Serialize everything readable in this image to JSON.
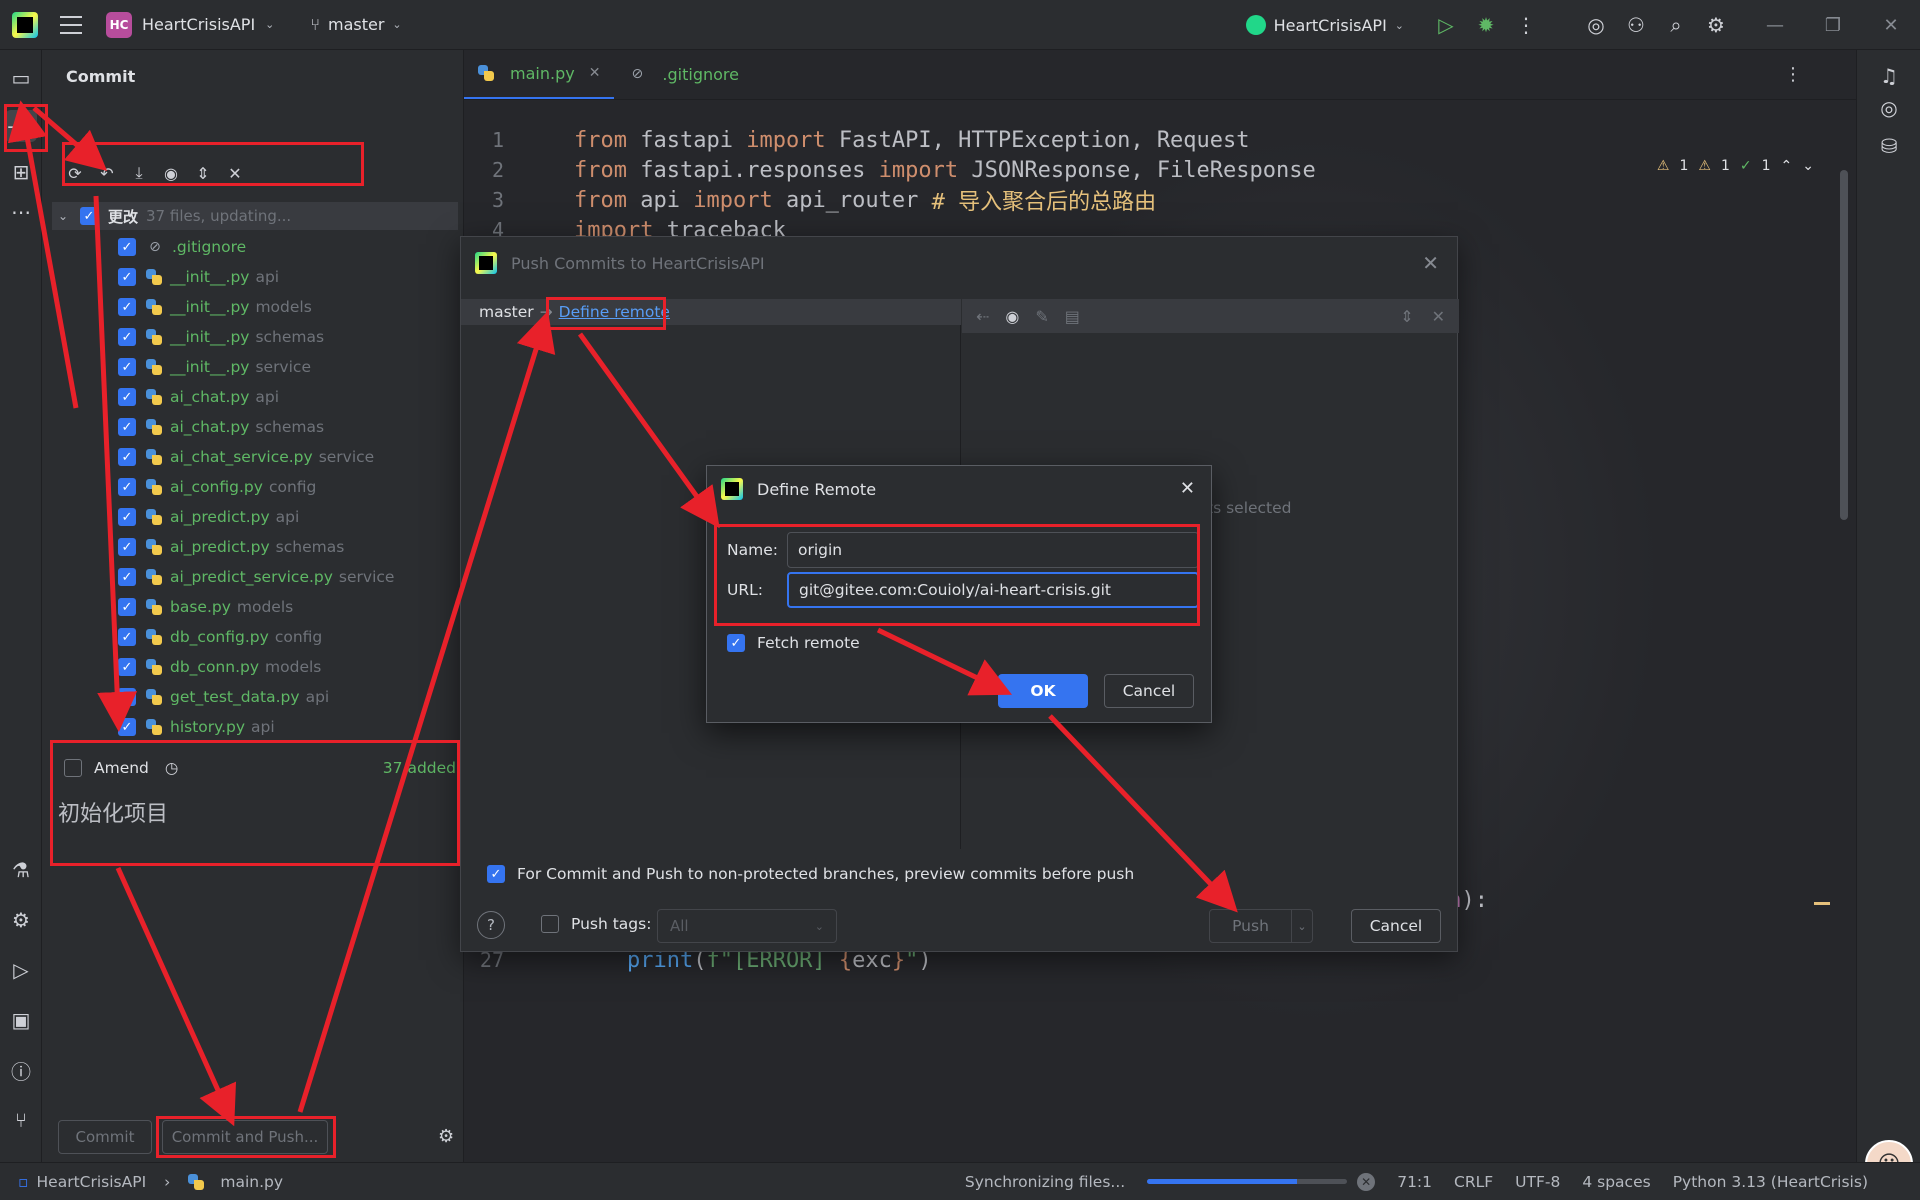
{
  "titlebar": {
    "project_badge": "HC",
    "project_name": "HeartCrisisAPI",
    "branch": "master",
    "run_config": "HeartCrisisAPI"
  },
  "commit_panel": {
    "title": "Commit",
    "group": {
      "name": "更改",
      "meta": "37 files, updating..."
    },
    "files": [
      {
        "name": ".gitignore",
        "dir": "",
        "icon": "ignore-file-icon"
      },
      {
        "name": "__init__.py",
        "dir": "api",
        "icon": "python-file-icon"
      },
      {
        "name": "__init__.py",
        "dir": "models",
        "icon": "python-file-icon"
      },
      {
        "name": "__init__.py",
        "dir": "schemas",
        "icon": "python-file-icon"
      },
      {
        "name": "__init__.py",
        "dir": "service",
        "icon": "python-file-icon"
      },
      {
        "name": "ai_chat.py",
        "dir": "api",
        "icon": "python-file-icon"
      },
      {
        "name": "ai_chat.py",
        "dir": "schemas",
        "icon": "python-file-icon"
      },
      {
        "name": "ai_chat_service.py",
        "dir": "service",
        "icon": "python-file-icon"
      },
      {
        "name": "ai_config.py",
        "dir": "config",
        "icon": "python-file-icon"
      },
      {
        "name": "ai_predict.py",
        "dir": "api",
        "icon": "python-file-icon"
      },
      {
        "name": "ai_predict.py",
        "dir": "schemas",
        "icon": "python-file-icon"
      },
      {
        "name": "ai_predict_service.py",
        "dir": "service",
        "icon": "python-file-icon"
      },
      {
        "name": "base.py",
        "dir": "models",
        "icon": "python-file-icon"
      },
      {
        "name": "db_config.py",
        "dir": "config",
        "icon": "python-file-icon"
      },
      {
        "name": "db_conn.py",
        "dir": "models",
        "icon": "python-file-icon"
      },
      {
        "name": "get_test_data.py",
        "dir": "api",
        "icon": "python-file-icon"
      },
      {
        "name": "history.py",
        "dir": "api",
        "icon": "python-file-icon"
      }
    ],
    "amend_label": "Amend",
    "added_count": "37 added",
    "commit_message": "初始化项目",
    "commit_button": "Commit",
    "commit_push_button": "Commit and Push..."
  },
  "editor": {
    "tabs": [
      {
        "label": "main.py",
        "active": true
      },
      {
        "label": ".gitignore",
        "active": false
      }
    ],
    "inspections": {
      "warn1": "1",
      "warn2": "1",
      "ok": "1"
    }
  },
  "push_dialog": {
    "title": "Push Commits to HeartCrisisAPI",
    "branch": "master",
    "define_remote_link": "Define remote",
    "no_selection": "ts selected",
    "preview_option": "For Commit and Push to non-protected branches, preview commits before push",
    "push_tags_label": "Push tags:",
    "push_tags_value": "All",
    "push_button": "Push",
    "cancel_button": "Cancel"
  },
  "define_remote_dialog": {
    "title": "Define Remote",
    "name_label": "Name:",
    "name_value": "origin",
    "url_label": "URL:",
    "url_value": "git@gitee.com:Couioly/ai-heart-crisis.git",
    "fetch_label": "Fetch remote",
    "ok_button": "OK",
    "cancel_button": "Cancel"
  },
  "statusbar": {
    "project": "HeartCrisisAPI",
    "file": "main.py",
    "task": "Synchronizing files...",
    "progress": 0.75,
    "position": "71:1",
    "line_sep": "CRLF",
    "encoding": "UTF-8",
    "indent": "4 spaces",
    "interpreter": "Python 3.13 (HeartCrisis)"
  },
  "colors": {
    "accent": "#3574f0",
    "annotation": "#e8212a",
    "added_file": "#5fb865"
  }
}
